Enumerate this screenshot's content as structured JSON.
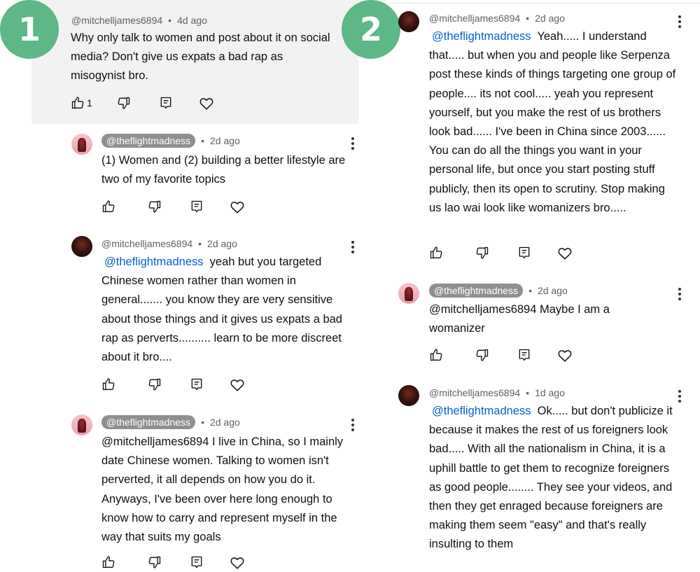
{
  "badges": {
    "left": "1",
    "right": "2"
  },
  "left_column": {
    "comments": [
      {
        "author": "@mitchelljames6894",
        "time": "4d ago",
        "text": "Why only talk to women and post about it on social media?  Don't give us expats a bad rap as misogynist bro.",
        "likes": "1"
      },
      {
        "author": "@theflightmadness",
        "time": "2d ago",
        "text": "(1) Women and (2) building a better lifestyle are two of my favorite topics"
      },
      {
        "author": "@mitchelljames6894",
        "time": "2d ago",
        "mention": "@theflightmadness",
        "text": "yeah but you targeted Chinese women rather than women in general....... you know they are very sensitive about those things and it gives us expats a bad rap as perverts..........  learn to be more discreet about it bro...."
      },
      {
        "author": "@theflightmadness",
        "time": "2d ago",
        "text": "@mitchelljames6894  I live in China, so I mainly date Chinese women. Talking to women isn't perverted, it all depends on how you do it. Anyways, I've been over here long enough to know how to carry and represent myself in the way that suits my goals"
      }
    ]
  },
  "right_column": {
    "comments": [
      {
        "author": "@mitchelljames6894",
        "time": "2d ago",
        "mention": "@theflightmadness",
        "text": "Yeah..... I understand that..... but when you and people like Serpenza post these kinds of things targeting one group of people.... its not cool..... yeah you represent yourself, but you make the rest of us brothers look bad...... I've been in China since 2003...... You can do all the things you want in your personal life, but once you start posting stuff publicly, then its open to scrutiny.  Stop making us lao wai look like womanizers bro....."
      },
      {
        "author": "@theflightmadness",
        "time": "2d ago",
        "text": "@mitchelljames6894  Maybe I am a womanizer"
      },
      {
        "author": "@mitchelljames6894",
        "time": "1d ago",
        "mention": "@theflightmadness",
        "text": "Ok..... but don't publicize it because it makes the rest of us foreigners look bad..... With all the nationalism in China, it is a uphill battle to get them to recognize foreigners as good people........  They see your videos, and then they get enraged because foreigners are making them seem \"easy\" and that's really insulting to them"
      }
    ]
  },
  "icons": [
    "like-icon",
    "dislike-icon",
    "reply-icon",
    "heart-icon",
    "more-options-icon"
  ],
  "colors": {
    "badge": "#5db787",
    "mention": "#065fd4",
    "pill": "#8f8f8f",
    "highlight": "#f2f2f2"
  }
}
